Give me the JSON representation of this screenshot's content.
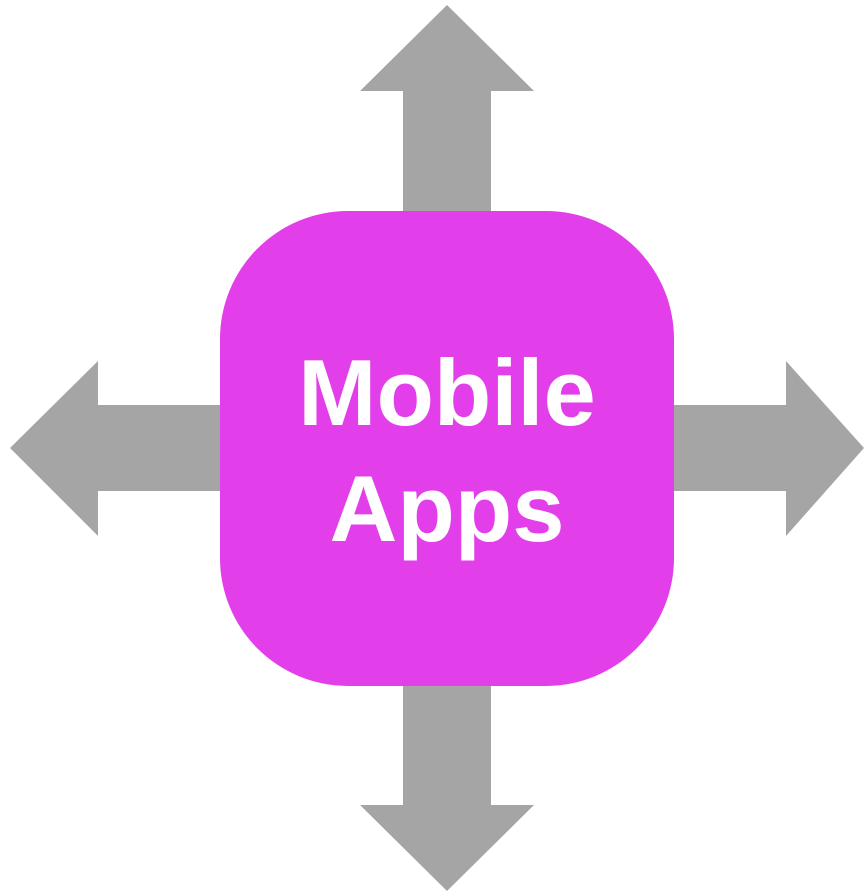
{
  "center_box": {
    "line1": "Mobile",
    "line2": "Apps"
  },
  "colors": {
    "box_fill": "#e23fea",
    "box_text": "#ffffff",
    "arrow_fill": "#a5a5a5",
    "background": "#ffffff"
  },
  "arrows": [
    {
      "direction": "up",
      "icon": "arrow-up-icon"
    },
    {
      "direction": "down",
      "icon": "arrow-down-icon"
    },
    {
      "direction": "left",
      "icon": "arrow-left-icon"
    },
    {
      "direction": "right",
      "icon": "arrow-right-icon"
    }
  ]
}
